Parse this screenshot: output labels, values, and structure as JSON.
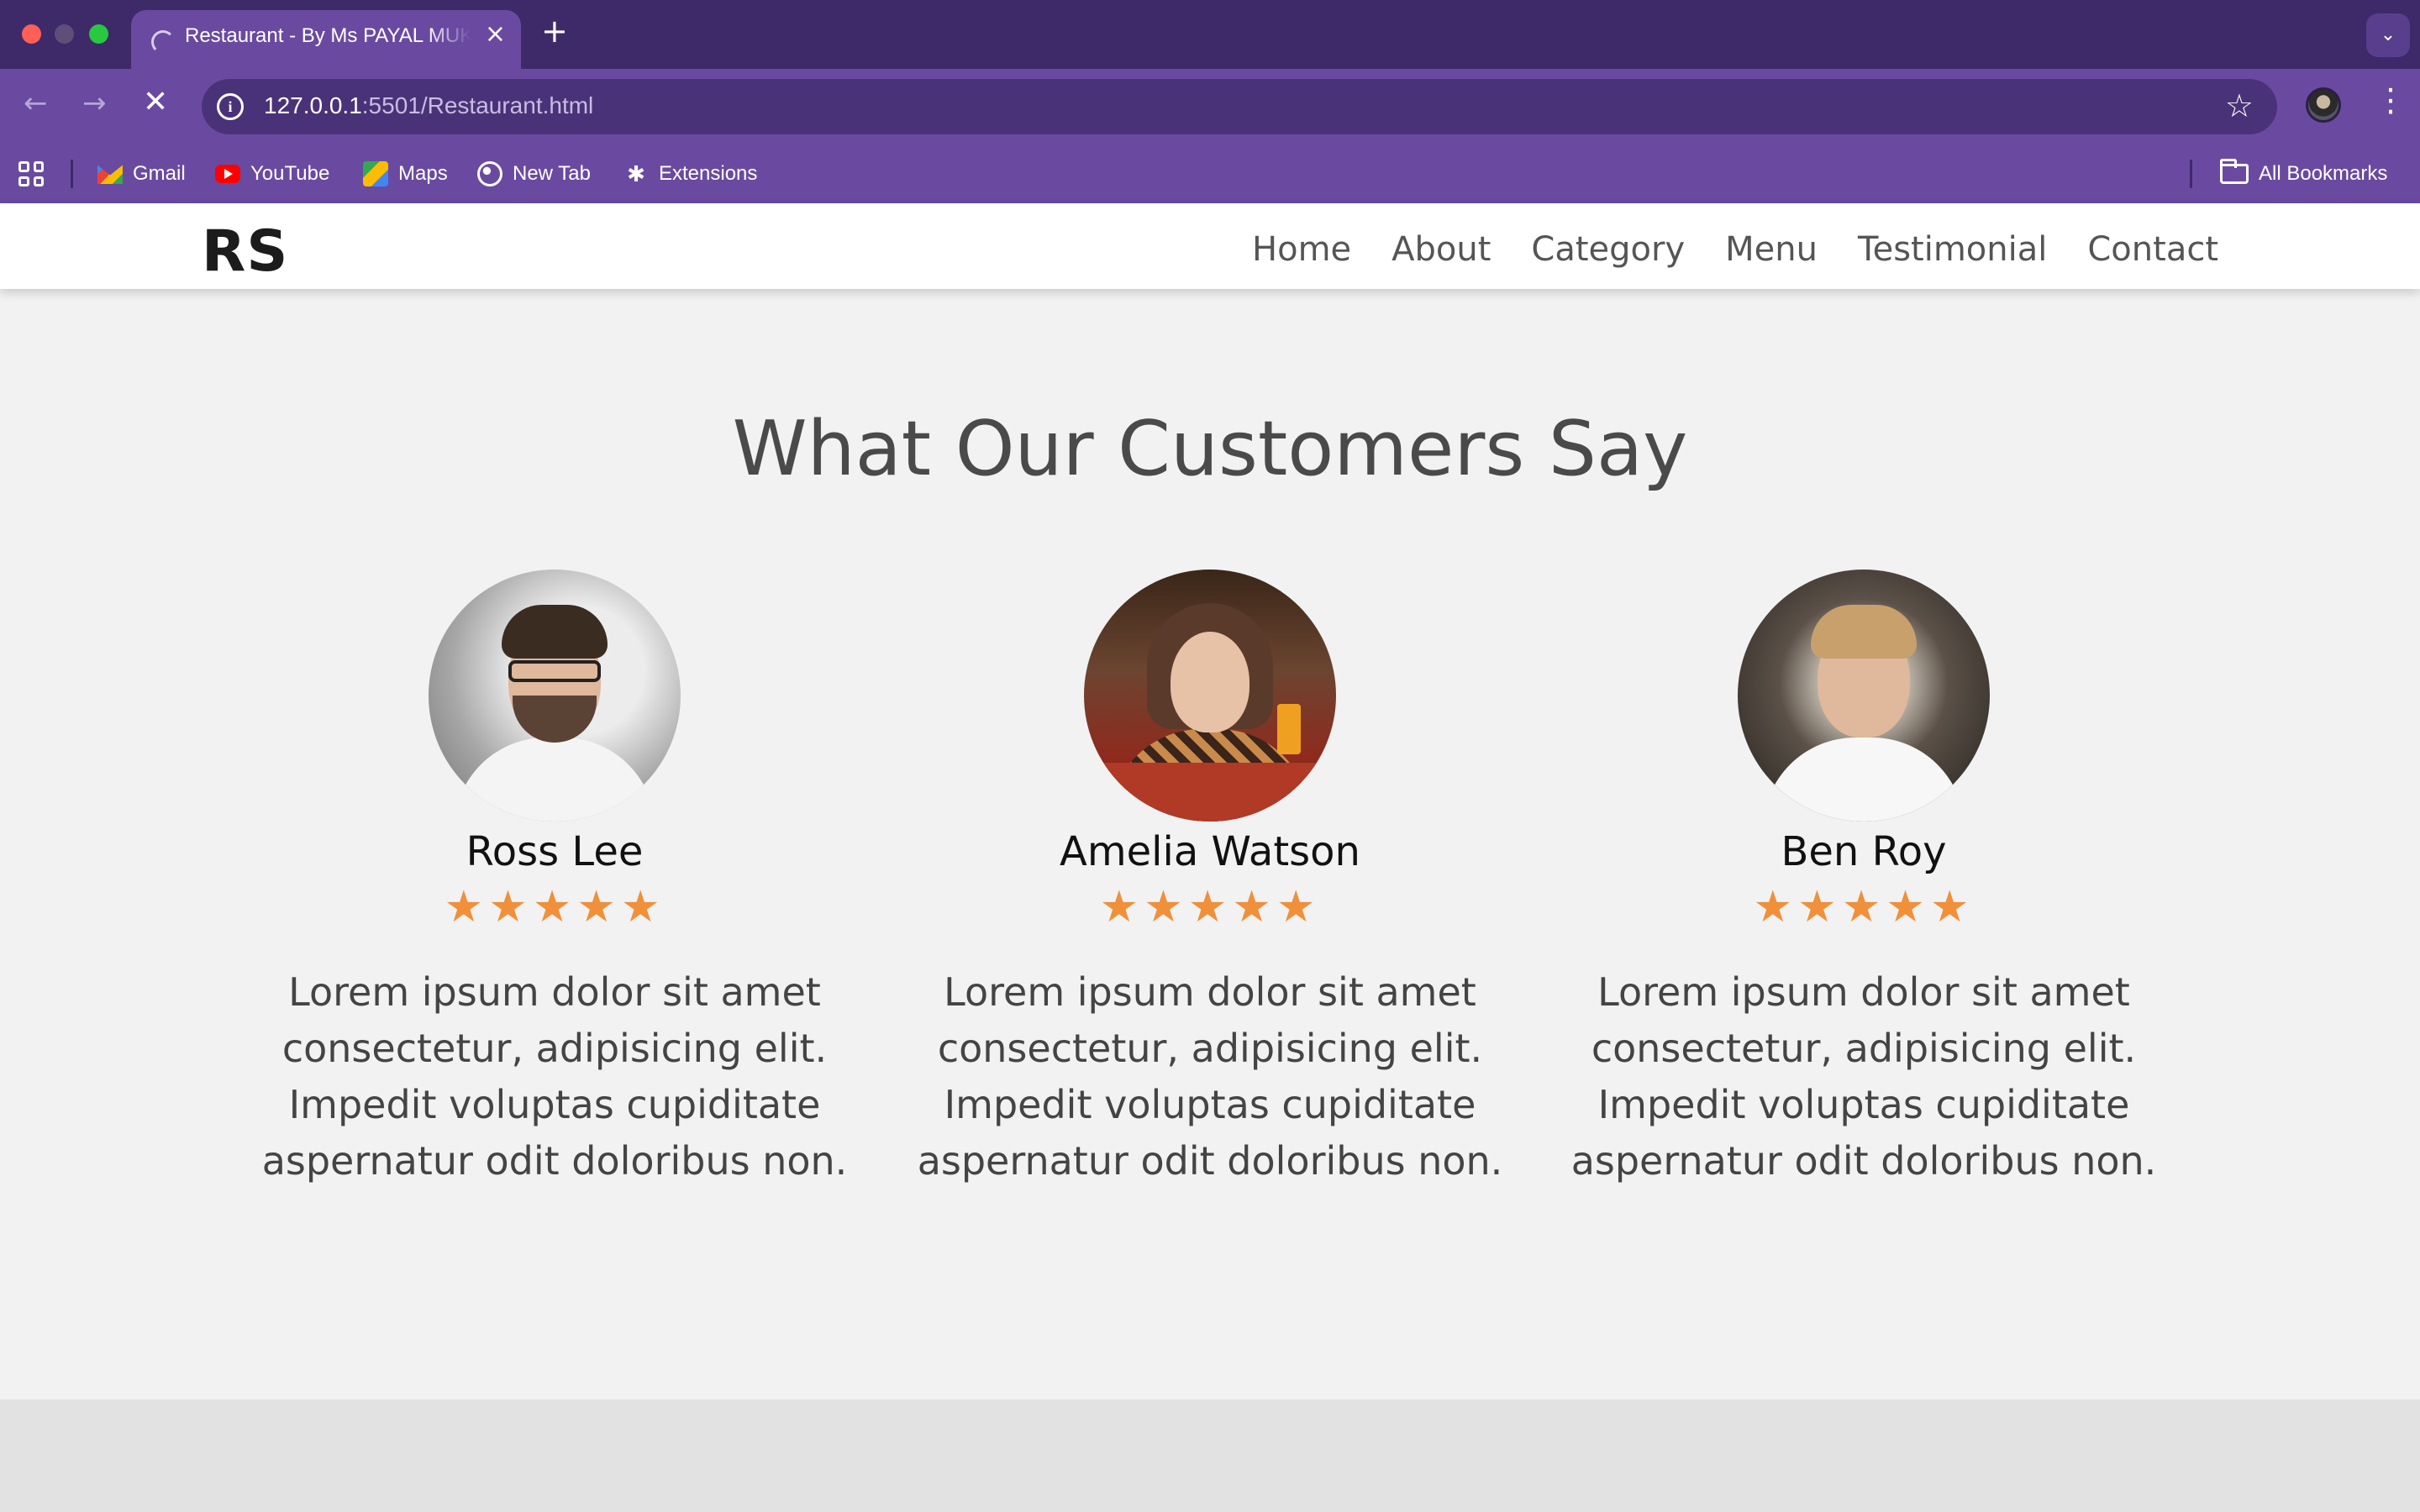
{
  "browser": {
    "tab": {
      "title": "Restaurant - By Ms PAYAL MUKHERJEE"
    },
    "url": {
      "host": "127.0.0.1",
      "path": ":5501/Restaurant.html"
    },
    "bookmarks": [
      {
        "label": "Gmail",
        "icon": "gmail-icon"
      },
      {
        "label": "YouTube",
        "icon": "youtube-icon"
      },
      {
        "label": "Maps",
        "icon": "maps-icon"
      },
      {
        "label": "New Tab",
        "icon": "globe-icon"
      },
      {
        "label": "Extensions",
        "icon": "puzzle-icon"
      }
    ],
    "all_bookmarks": "All Bookmarks"
  },
  "site": {
    "logo": "RS",
    "nav": [
      "Home",
      "About",
      "Category",
      "Menu",
      "Testimonial",
      "Contact"
    ]
  },
  "testimonials": {
    "heading": "What Our Customers Say",
    "items": [
      {
        "name": "Ross Lee",
        "rating": 5,
        "stars": "★★★★★",
        "review": "Lorem ipsum dolor sit amet consectetur, adipisicing elit. Impedit voluptas cupiditate aspernatur odit doloribus non."
      },
      {
        "name": "Amelia Watson",
        "rating": 5,
        "stars": "★★★★★",
        "review": "Lorem ipsum dolor sit amet consectetur, adipisicing elit. Impedit voluptas cupiditate aspernatur odit doloribus non."
      },
      {
        "name": "Ben Roy",
        "rating": 5,
        "stars": "★★★★★",
        "review": "Lorem ipsum dolor sit amet consectetur, adipisicing elit. Impedit voluptas cupiditate aspernatur odit doloribus non."
      }
    ]
  },
  "colors": {
    "chrome_dark": "#3e2a68",
    "chrome": "#6a4aa0",
    "star": "#f0903a",
    "page_bg": "#f2f2f2"
  }
}
